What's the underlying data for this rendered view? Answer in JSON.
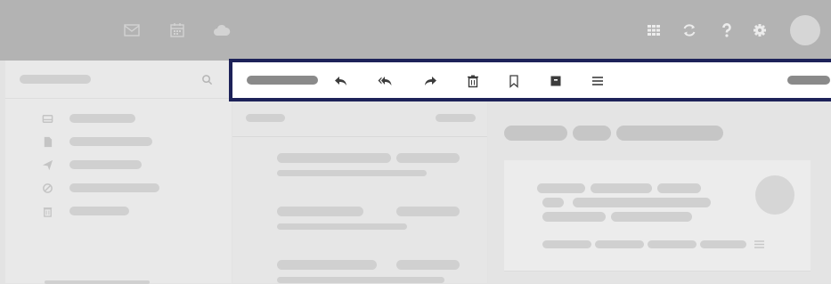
{
  "header": {
    "icons": [
      "mail-icon",
      "calendar-icon",
      "cloud-icon",
      "apps-grid-icon",
      "refresh-icon",
      "help-icon",
      "settings-icon"
    ]
  },
  "toolbar": {
    "icons": [
      "reply-icon",
      "reply-all-icon",
      "forward-icon",
      "delete-icon",
      "bookmark-icon",
      "archive-icon",
      "menu-icon"
    ]
  },
  "sidebar": {
    "folder_icons": [
      "inbox-icon",
      "drafts-icon",
      "sent-icon",
      "spam-icon",
      "trash-icon"
    ]
  },
  "colors": {
    "header_bg": "#b3b3b3",
    "toolbar_highlight": "#1d2259",
    "toolbar_icon": "#3c3c3c",
    "placeholder": "#d0d0d0"
  }
}
